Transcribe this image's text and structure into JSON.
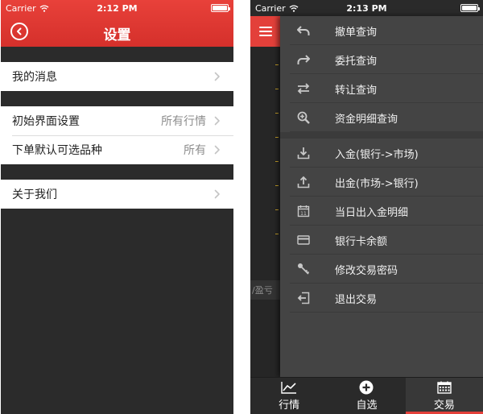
{
  "left": {
    "status": {
      "carrier": "Carrier",
      "time": "2:12 PM"
    },
    "header": {
      "title": "设置"
    },
    "groups": [
      [
        {
          "label": "我的消息",
          "value": ""
        }
      ],
      [
        {
          "label": "初始界面设置",
          "value": "所有行情"
        },
        {
          "label": "下单默认可选品种",
          "value": "所有"
        }
      ],
      [
        {
          "label": "关于我们",
          "value": ""
        }
      ]
    ]
  },
  "right": {
    "status": {
      "carrier": "Carrier",
      "time": "2:13 PM"
    },
    "background_label": "/盈亏",
    "menu_section1": [
      {
        "label": "撤单查询",
        "icon": "undo-arrow-icon"
      },
      {
        "label": "委托查询",
        "icon": "redo-arrow-icon"
      },
      {
        "label": "转让查询",
        "icon": "transfer-arrows-icon"
      },
      {
        "label": "资金明细查询",
        "icon": "zoom-in-icon"
      }
    ],
    "menu_section2": [
      {
        "label": "入金(银行->市场)",
        "icon": "download-tray-icon"
      },
      {
        "label": "出金(市场->银行)",
        "icon": "upload-tray-icon"
      },
      {
        "label": "当日出入金明细",
        "icon": "calendar-icon"
      },
      {
        "label": "银行卡余额",
        "icon": "credit-card-icon"
      },
      {
        "label": "修改交易密码",
        "icon": "key-icon"
      },
      {
        "label": "退出交易",
        "icon": "logout-icon"
      }
    ],
    "tabs": [
      {
        "label": "行情",
        "icon": "line-chart-icon",
        "active": false
      },
      {
        "label": "自选",
        "icon": "plus-circle-icon",
        "active": false
      },
      {
        "label": "交易",
        "icon": "calendar-grid-icon",
        "active": true
      }
    ]
  },
  "colors": {
    "accent_red": "#e3403a",
    "drawer_bg": "#444444",
    "row_bg": "#ffffff"
  }
}
